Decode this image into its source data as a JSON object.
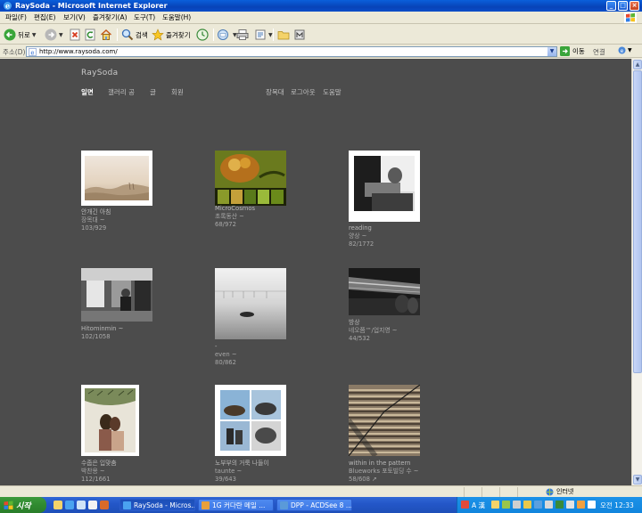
{
  "window": {
    "title": "RaySoda - Microsoft Internet Explorer"
  },
  "menu": [
    {
      "label": "파일(F)"
    },
    {
      "label": "편집(E)"
    },
    {
      "label": "보기(V)"
    },
    {
      "label": "즐겨찾기(A)"
    },
    {
      "label": "도구(T)"
    },
    {
      "label": "도움말(H)"
    }
  ],
  "toolbar": {
    "back_label": "뒤로",
    "search_label": "검색",
    "favorites_label": "즐겨찾기"
  },
  "address": {
    "label": "주소(D)",
    "url": "http://www.raysoda.com/",
    "go_label": "이동",
    "links_label": "연결"
  },
  "site": {
    "logo": "RaySoda",
    "nav_left": [
      "일면",
      "갤러리 공",
      "글",
      "회원"
    ],
    "nav_right": [
      "장목대",
      "로그아웃",
      "도움말"
    ]
  },
  "photos": [
    {
      "title": "안개긴 아침",
      "author": "장목대 ~",
      "stats": "103/929"
    },
    {
      "title": "MicroCosmos",
      "author": "초록동산 ~",
      "stats": "68/972"
    },
    {
      "title": "reading",
      "author": "양상 ~",
      "stats": "82/1772"
    },
    {
      "title": "Hitominmin ~",
      "author": "",
      "stats": "102/1058"
    },
    {
      "title": "-",
      "author": "even ~",
      "stats": "80/862"
    },
    {
      "title": "방상",
      "author": "네오쯤™/업지영 ~",
      "stats": "44/532"
    },
    {
      "title": "수줍은 입맞춤",
      "author": "박찬용 ~",
      "stats": "112/1661"
    },
    {
      "title": "노부부의 거룩 나들이",
      "author": "taunte ~",
      "stats": "39/643"
    },
    {
      "title": "within in the pattern",
      "author": "Blueworks 포토빌딩 수 ~",
      "stats": "58/608 ↗"
    }
  ],
  "status": {
    "zone": "인터넷"
  },
  "taskbar": {
    "start_label": "시작",
    "tasks": [
      {
        "label": "RaySoda - Micros..."
      },
      {
        "label": "1G 커다란 메일 ..."
      },
      {
        "label": "DPP - ACDSee 8 ..."
      }
    ],
    "clock": "오전 12:33",
    "lang": "A 漢"
  },
  "colors": {
    "viewport_bg": "#4c4c4c",
    "titlebar": "#0a4ec9",
    "taskbar": "#2457c9",
    "start": "#2f8a2f"
  }
}
